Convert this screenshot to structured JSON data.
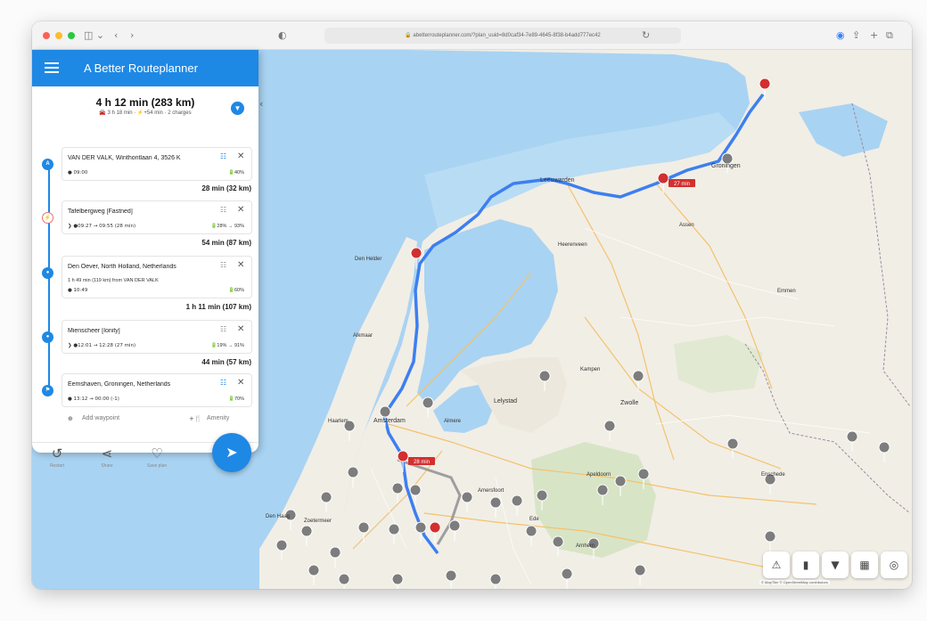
{
  "browser": {
    "url": "abetterrouteplanner.com/?plan_uuid=8d0caf34-7e89-4645-8f38-b4add777ec42",
    "traffic_light_colors": [
      "#ff5f57",
      "#febc2e",
      "#28c840"
    ]
  },
  "header": {
    "title": "A Better Routeplanner"
  },
  "summary": {
    "total": "4 h 12 min (283 km)",
    "detail": "🚘 3 h 18 min · ⚡+54 min · 2 charges"
  },
  "waypoints": [
    {
      "marker": "A",
      "name": "VAN DER VALK, Winthontlaan 4, 3526 K",
      "line": "● 09:00",
      "battery": "🔋40%"
    },
    {
      "marker": "⚡",
      "name": "Tafelbergweg [Fastned]",
      "line": "❯  ●09:27 → 09:55 (28 min)",
      "battery": "🔋28% → 93%"
    },
    {
      "marker": "●",
      "name": "Den Oever, North Holland, Netherlands",
      "line1": "1 h 49 min (119 km) from VAN DER VALK",
      "line": "● 10:49",
      "battery": "🔋60%"
    },
    {
      "marker": "●",
      "name": "Mienscheer [Ionity]",
      "line": "❯  ●12:01 → 12:28 (27 min)",
      "battery": "🔋19% → 91%"
    },
    {
      "marker": "⚑",
      "name": "Eemshaven, Groningen, Netherlands",
      "line": "● 13:12 → 00:00 (-1)",
      "battery": "🔋70%"
    }
  ],
  "legs": [
    "28 min (32 km)",
    "54 min (87 km)",
    "1 h 11 min (107 km)",
    "44 min (57 km)"
  ],
  "actions": {
    "add_waypoint": "Add waypoint",
    "amenity": "Amenity",
    "restart": "Restart",
    "share": "Share",
    "save_plan": "Save plan"
  },
  "map_labels": {
    "leeuwarden": "Leeuwarden",
    "groningen": "Groningen",
    "den_helder": "Den Helder",
    "alkmaar": "Alkmaar",
    "lelystad": "Lelystad",
    "zwolle": "Zwolle",
    "amsterdam": "Amsterdam",
    "almere": "Almere",
    "haarlem": "Haarlem",
    "amersfoort": "Amersfoort",
    "apeldoorn": "Apeldoorn",
    "enschede": "Enschede",
    "arnhem": "Arnhem",
    "ede": "Ede",
    "den_haag": "Den Haag",
    "zoetermeer": "Zoetermeer",
    "assen": "Assen",
    "emmen": "Emmen",
    "kampen": "Kampen",
    "heerenveen": "Heerenveen"
  },
  "map_badges": {
    "charge1": "27 min",
    "charge2": "28 min"
  },
  "attribution": "© MapTiler © OpenStreetMap contributors",
  "colors": {
    "accent": "#1e88e5",
    "water": "#a9d3f2",
    "land": "#f1eee6",
    "route": "#3d7ff0"
  }
}
